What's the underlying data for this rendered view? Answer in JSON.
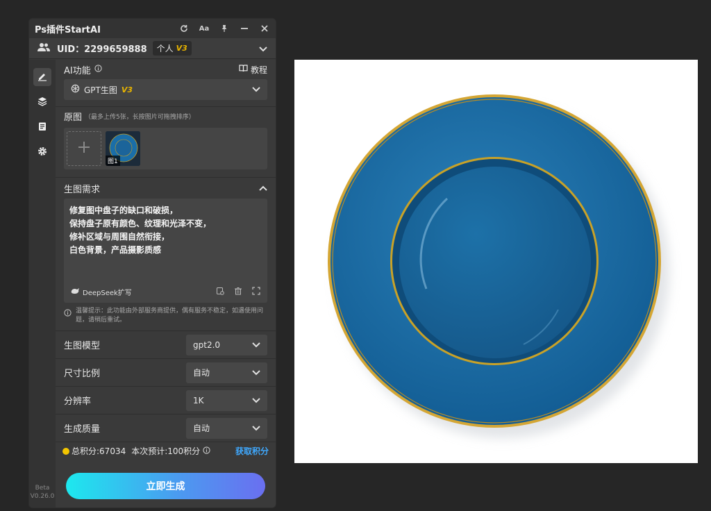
{
  "window": {
    "title": "Ps插件StartAI"
  },
  "account": {
    "uid": "UID：2299659888",
    "type": "个人",
    "tier": "V3"
  },
  "rail": {
    "version_line1": "Beta",
    "version_line2": "V0.26.0"
  },
  "ai_feature": {
    "label": "AI功能",
    "tutorial": "教程",
    "selected": "GPT生图",
    "selected_tier": "V3"
  },
  "source_images": {
    "label": "原图",
    "hint": "（最多上传5张，长按图片可拖拽排序）",
    "thumb_tag": "图1"
  },
  "prompt": {
    "label": "生图需求",
    "text": "修复图中盘子的缺口和破损，\n保持盘子原有颜色、纹理和光泽不变，\n修补区域与周围自然衔接，\n白色背景，产品摄影质感",
    "expand_label": "DeepSeek扩写"
  },
  "notice": {
    "text": "温馨提示：此功能由外部服务商提供，偶有服务不稳定，如遇使用问题，请稍后重试。"
  },
  "options": [
    {
      "label": "生图模型",
      "value": "gpt2.0"
    },
    {
      "label": "尺寸比例",
      "value": "自动"
    },
    {
      "label": "分辨率",
      "value": "1K"
    },
    {
      "label": "生成质量",
      "value": "自动"
    }
  ],
  "points": {
    "total": "总积分:67034",
    "estimate": "本次预计:100积分",
    "get_link": "获取积分"
  },
  "generate_button": "立即生成",
  "colors": {
    "accent": "#3fa9ff",
    "tier": "#e8b400",
    "plate_blue": "#1a6ea8",
    "gold_rim": "#c9a227"
  }
}
